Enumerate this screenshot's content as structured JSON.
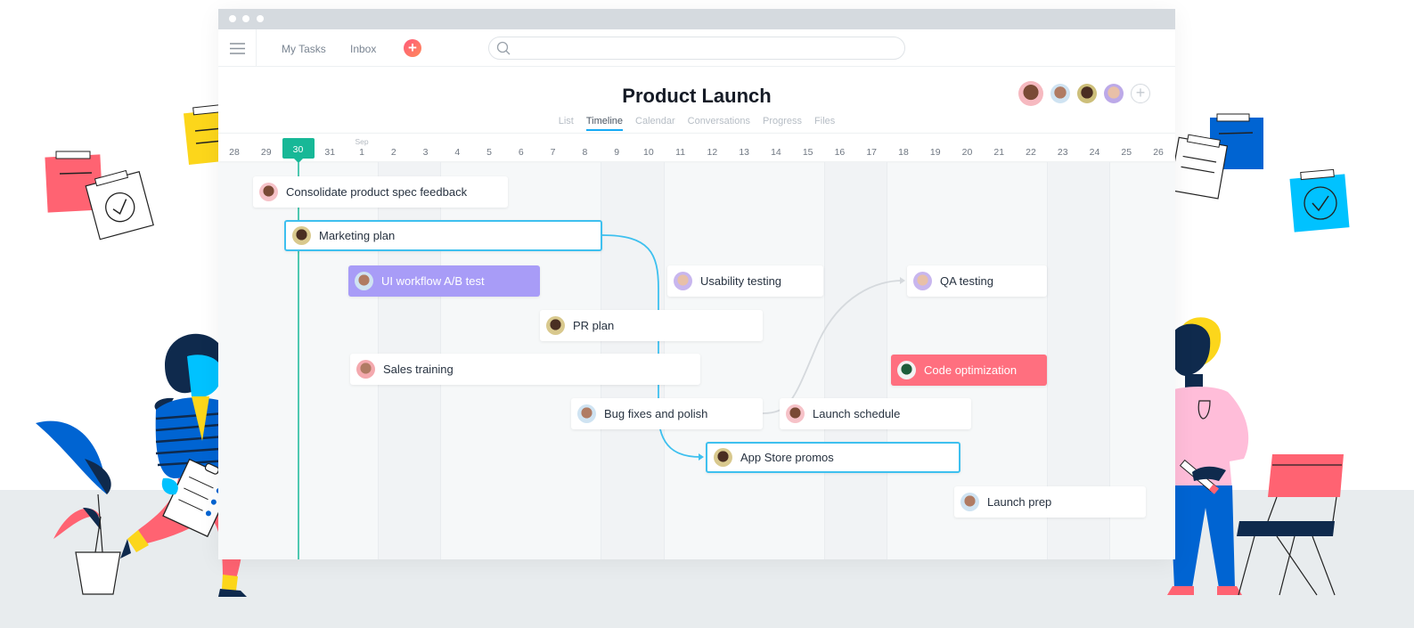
{
  "topbar": {
    "nav": [
      "My Tasks",
      "Inbox"
    ],
    "add_button_icon": "plus-icon",
    "search_placeholder": ""
  },
  "project": {
    "title": "Product Launch",
    "members": [
      "member-1",
      "member-2",
      "member-3",
      "member-4"
    ],
    "tabs": [
      {
        "label": "List",
        "active": false
      },
      {
        "label": "Timeline",
        "active": true
      },
      {
        "label": "Calendar",
        "active": false
      },
      {
        "label": "Conversations",
        "active": false
      },
      {
        "label": "Progress",
        "active": false
      },
      {
        "label": "Files",
        "active": false
      }
    ]
  },
  "timeline": {
    "month_label": "Sep",
    "today": "30",
    "dates": [
      "28",
      "29",
      "30",
      "31",
      "1",
      "2",
      "3",
      "4",
      "5",
      "6",
      "7",
      "8",
      "9",
      "10",
      "11",
      "12",
      "13",
      "14",
      "15",
      "16",
      "17",
      "18",
      "19",
      "20",
      "21",
      "22",
      "23",
      "24",
      "25",
      "26"
    ],
    "tasks": [
      {
        "name": "Consolidate product spec feedback",
        "style": "normal"
      },
      {
        "name": "Marketing plan",
        "style": "selected"
      },
      {
        "name": "UI workflow A/B test",
        "style": "purple"
      },
      {
        "name": "Usability testing",
        "style": "normal"
      },
      {
        "name": "QA testing",
        "style": "normal"
      },
      {
        "name": "PR plan",
        "style": "normal"
      },
      {
        "name": "Sales training",
        "style": "normal"
      },
      {
        "name": "Code optimization",
        "style": "red"
      },
      {
        "name": "Bug fixes and polish",
        "style": "normal"
      },
      {
        "name": "Launch schedule",
        "style": "normal"
      },
      {
        "name": "App Store promos",
        "style": "selected"
      },
      {
        "name": "Launch prep",
        "style": "normal"
      }
    ],
    "dependencies": [
      {
        "from": "Marketing plan",
        "to": "App Store promos",
        "color": "#3ec0ef"
      },
      {
        "from": "Bug fixes and polish",
        "to": "QA testing",
        "color": "#d5d9dd"
      }
    ]
  },
  "colors": {
    "accent": "#14aaf5",
    "today": "#17b897",
    "purple_task": "#a89cf7",
    "red_task": "#ff6f7f"
  }
}
